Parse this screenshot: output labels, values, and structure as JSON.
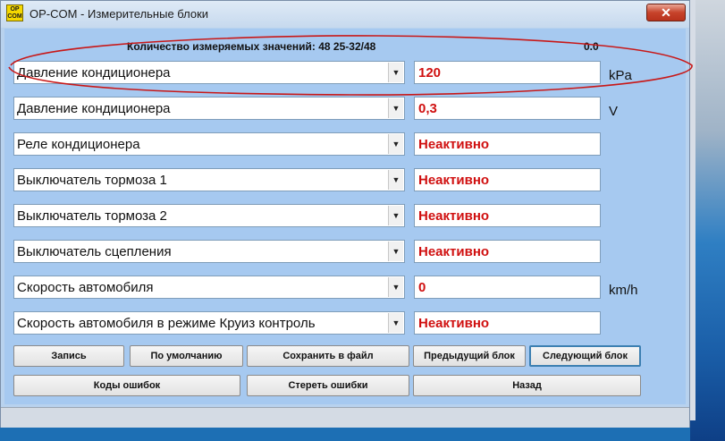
{
  "window": {
    "title": "OP-COM - Измерительные блоки",
    "app_icon_text": "OP\nCOM",
    "close_glyph": "✕"
  },
  "header": {
    "count_text": "Количество измеряемых значений: 48  25-32/48",
    "right_value": "0.0"
  },
  "rows": [
    {
      "label": "Давление кондиционера",
      "value": "120",
      "unit": "kPa"
    },
    {
      "label": "Давление кондиционера",
      "value": "0,3",
      "unit": "V"
    },
    {
      "label": "Реле кондиционера",
      "value": "Неактивно",
      "unit": ""
    },
    {
      "label": "Выключатель тормоза 1",
      "value": "Неактивно",
      "unit": ""
    },
    {
      "label": "Выключатель тормоза 2",
      "value": "Неактивно",
      "unit": ""
    },
    {
      "label": "Выключатель сцепления",
      "value": "Неактивно",
      "unit": ""
    },
    {
      "label": "Скорость автомобиля",
      "value": "0",
      "unit": "km/h"
    },
    {
      "label": "Скорость автомобиля в режиме Круиз контроль",
      "value": "Неактивно",
      "unit": ""
    }
  ],
  "dropdown_glyph": "▼",
  "buttons": {
    "record": "Запись",
    "default": "По умолчанию",
    "save_file": "Сохранить в файл",
    "prev_block": "Предыдущий блок",
    "next_block": "Следующий блок",
    "error_codes": "Коды ошибок",
    "clear_errors": "Стереть ошибки",
    "back": "Назад"
  },
  "colors": {
    "value_text": "#d01010",
    "annotation": "#c81818",
    "client_bg": "#a6c9f0"
  }
}
